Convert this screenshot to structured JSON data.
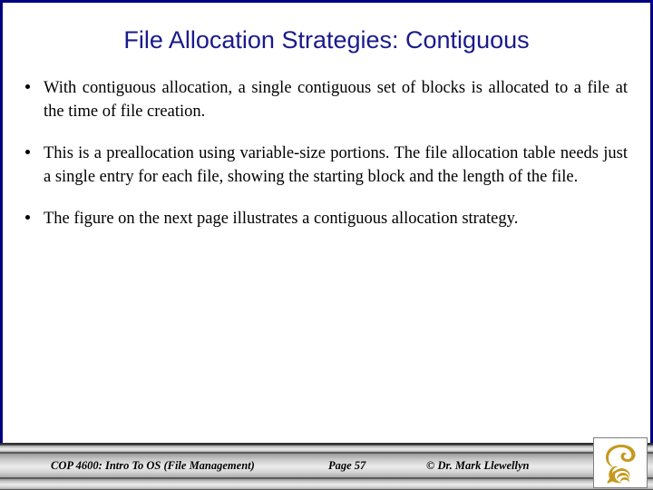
{
  "slide": {
    "title": "File Allocation Strategies: Contiguous",
    "title_color": "#1a1a8c",
    "border_color": "#000080",
    "background_color": "#ffffff",
    "bullets": [
      "With contiguous allocation, a single contiguous set of blocks is allocated to a file at the time of file creation.",
      "This is a preallocation using variable-size portions.  The file allocation table needs just a single entry for each file, showing the starting block and the length of the file.",
      "The figure on the next page illustrates a contiguous allocation strategy."
    ]
  },
  "footer": {
    "course": "COP 4600: Intro To OS  (File Management)",
    "page": "Page 57",
    "copyright": "© Dr. Mark Llewellyn",
    "logo_name": "ucf-pegasus-logo",
    "logo_color": "#c49a1e"
  }
}
